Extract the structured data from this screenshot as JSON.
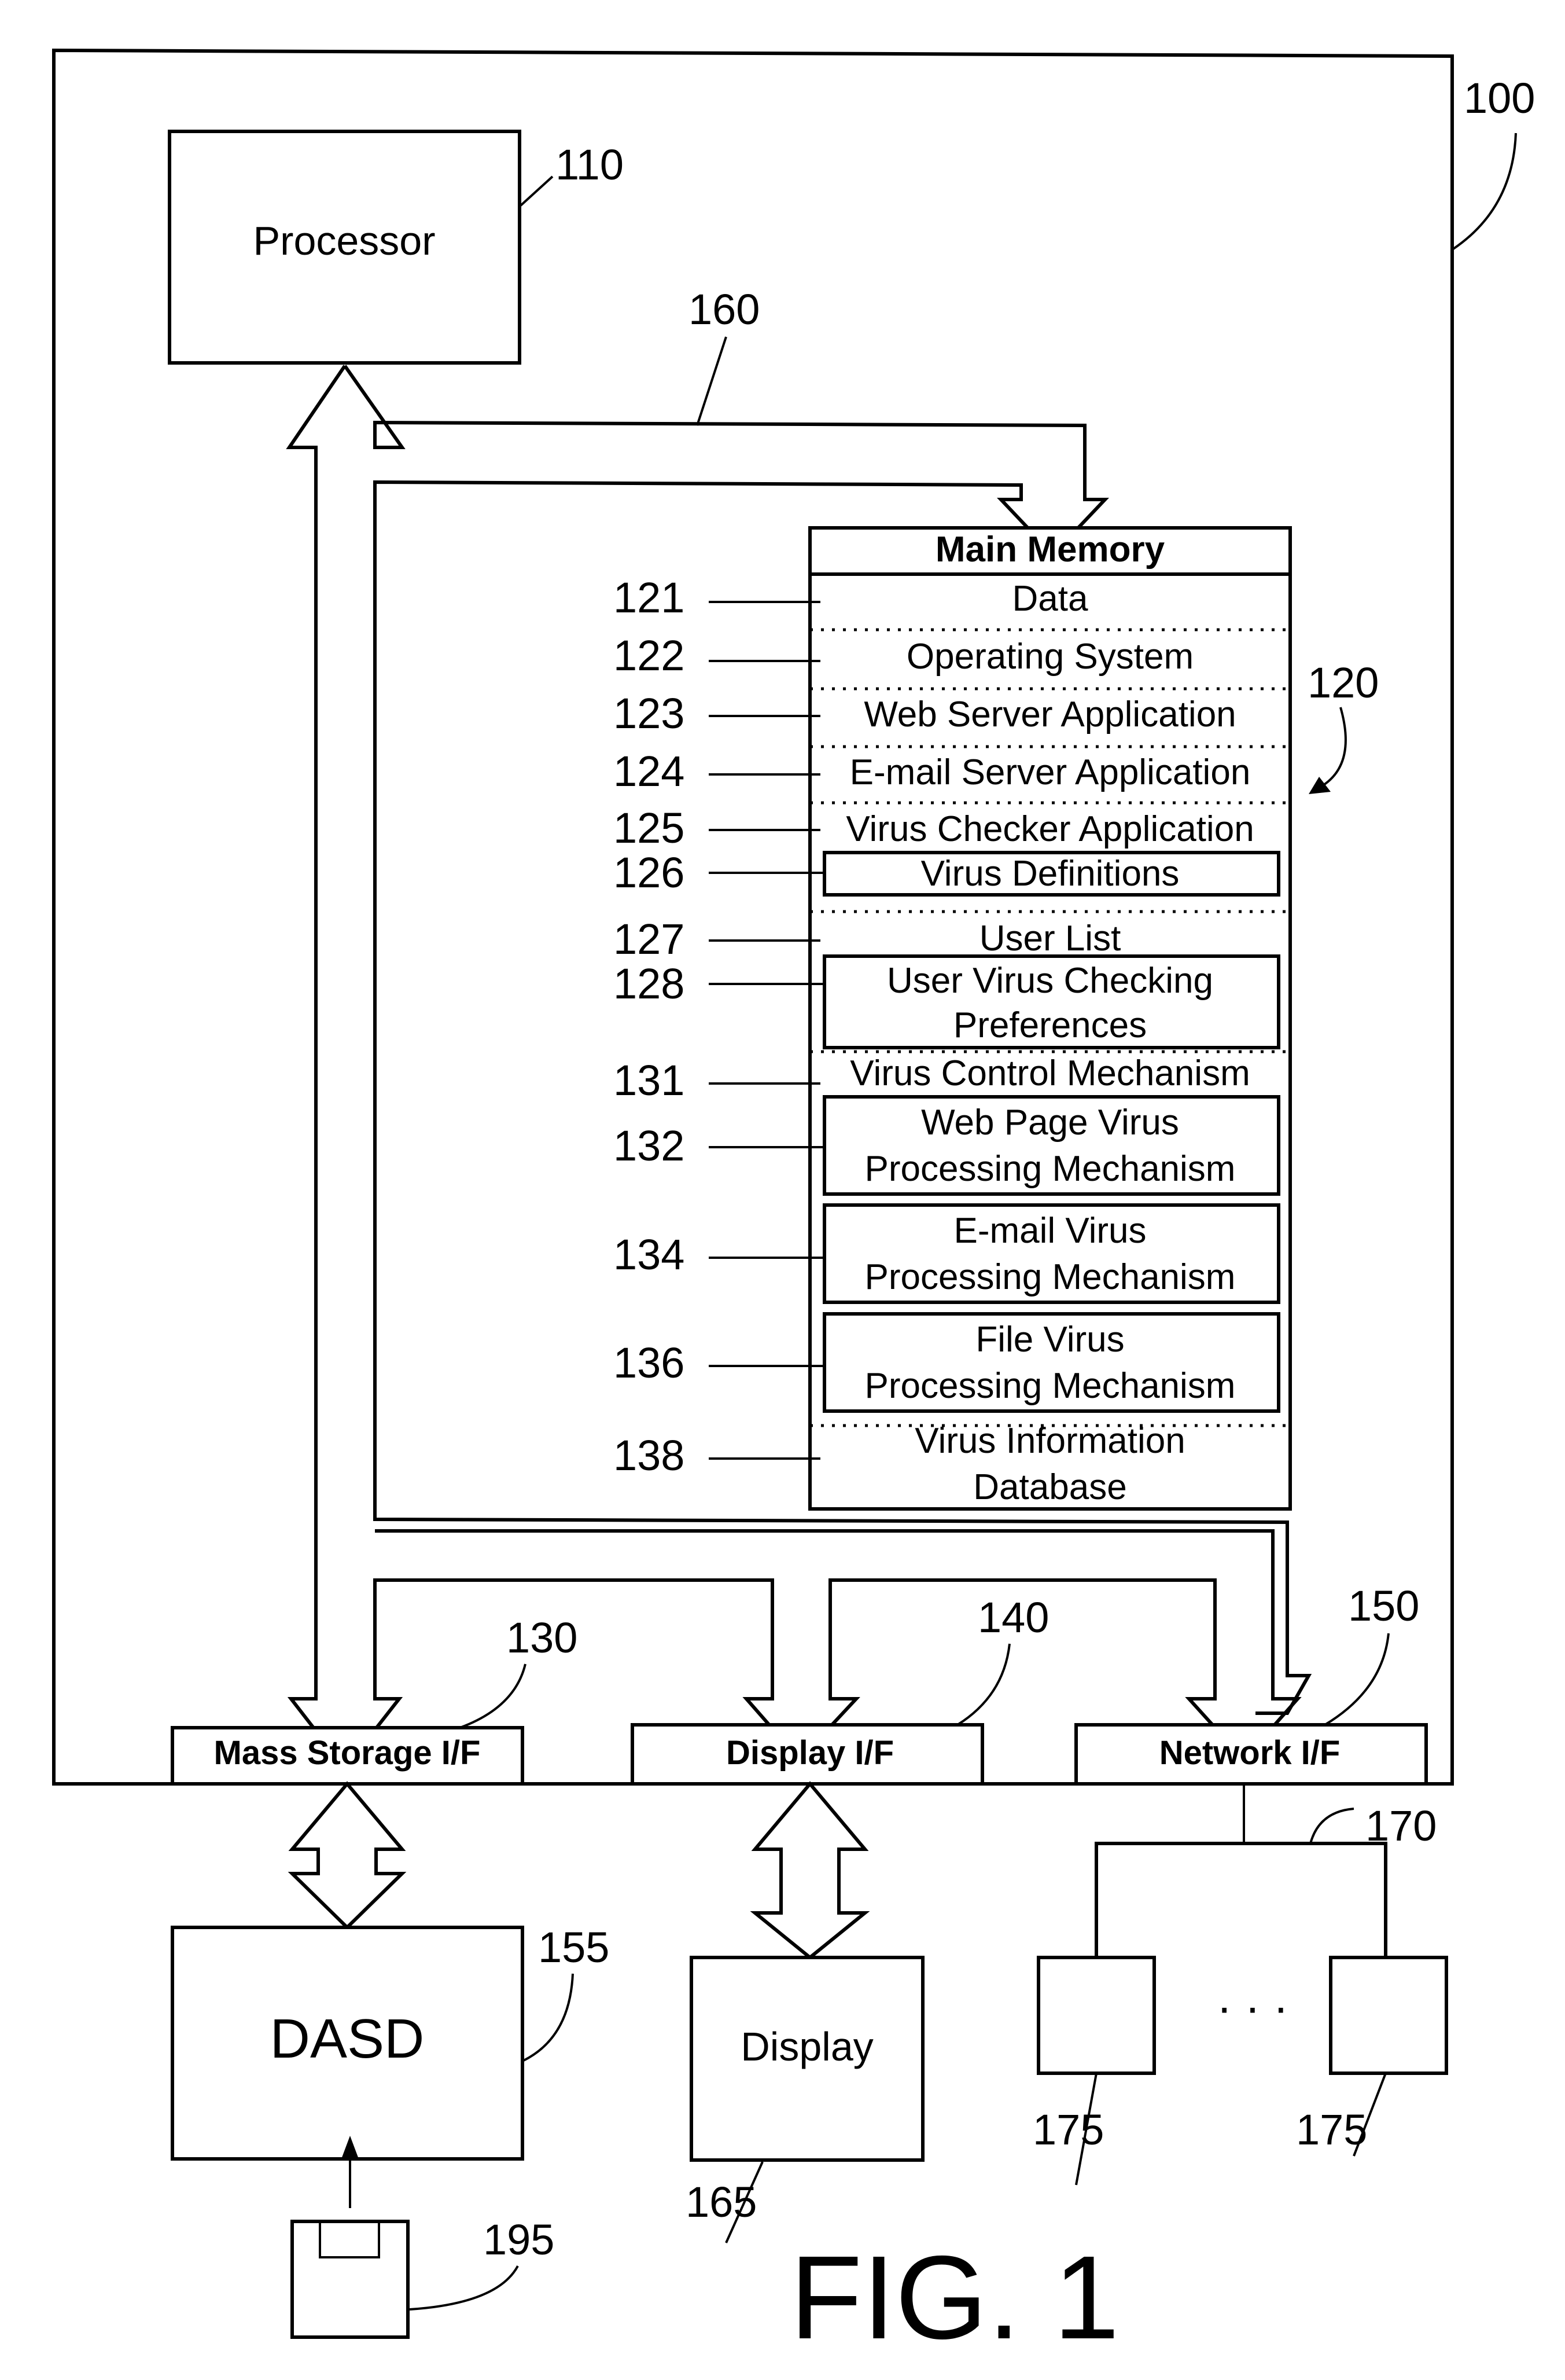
{
  "figure": {
    "title": "FIG. 1",
    "system_ref": "100",
    "processor": {
      "label": "Processor",
      "ref": "110"
    },
    "bus_ref": "160",
    "main_memory": {
      "title": "Main Memory",
      "ref": "120",
      "items": [
        {
          "ref": "121",
          "label": "Data"
        },
        {
          "ref": "122",
          "label": "Operating System"
        },
        {
          "ref": "123",
          "label": "Web Server Application"
        },
        {
          "ref": "124",
          "label": "E-mail Server Application"
        },
        {
          "ref": "125",
          "label": "Virus Checker Application"
        },
        {
          "ref": "126",
          "label": "Virus Definitions"
        },
        {
          "ref": "127",
          "label": "User List"
        },
        {
          "ref": "128",
          "label_line1": "User Virus Checking",
          "label_line2": "Preferences"
        },
        {
          "ref": "131",
          "label": "Virus Control Mechanism"
        },
        {
          "ref": "132",
          "label_line1": "Web Page Virus",
          "label_line2": "Processing Mechanism"
        },
        {
          "ref": "134",
          "label_line1": "E-mail Virus",
          "label_line2": "Processing Mechanism"
        },
        {
          "ref": "136",
          "label_line1": "File Virus",
          "label_line2": "Processing Mechanism"
        },
        {
          "ref": "138",
          "label_line1": "Virus Information",
          "label_line2": "Database"
        }
      ]
    },
    "interfaces": [
      {
        "label": "Mass Storage I/F",
        "ref": "130"
      },
      {
        "label": "Display I/F",
        "ref": "140"
      },
      {
        "label": "Network I/F",
        "ref": "150"
      }
    ],
    "dasd": {
      "label": "DASD",
      "ref": "155"
    },
    "display": {
      "label": "Display",
      "ref": "165"
    },
    "network": {
      "ref": "170",
      "node_ref": "175",
      "ellipsis": "· · ·"
    },
    "media": {
      "ref": "195"
    }
  }
}
